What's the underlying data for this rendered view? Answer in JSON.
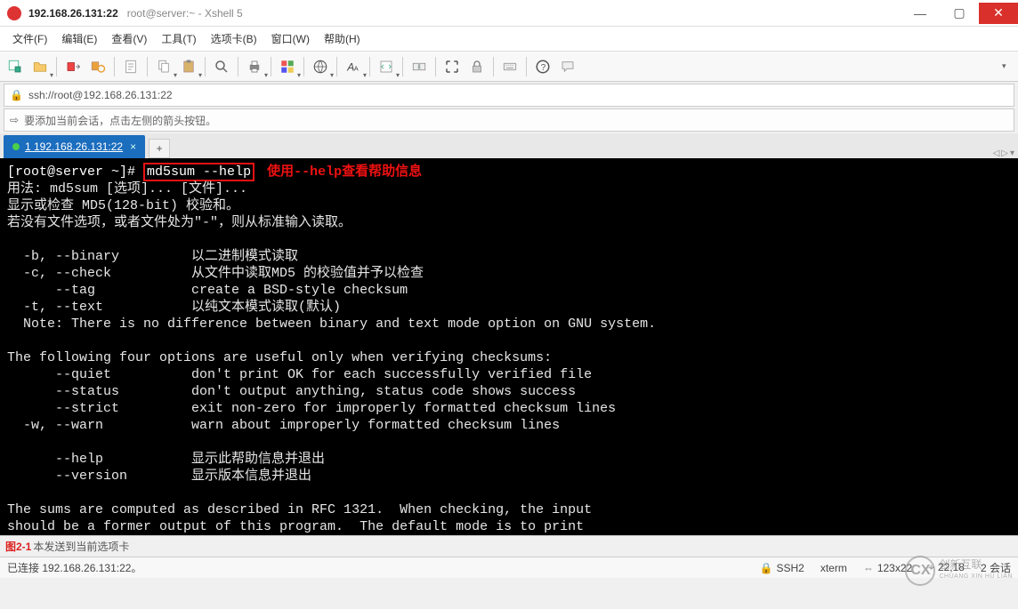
{
  "titlebar": {
    "host": "192.168.26.131:22",
    "caption": "root@server:~ - Xshell 5"
  },
  "win": {
    "min": "—",
    "max": "▢",
    "close": "✕"
  },
  "menu": [
    "文件(F)",
    "编辑(E)",
    "查看(V)",
    "工具(T)",
    "选项卡(B)",
    "窗口(W)",
    "帮助(H)"
  ],
  "addr": {
    "url": "ssh://root@192.168.26.131:22",
    "lock": "🔒"
  },
  "info": {
    "arrow": "⇨",
    "text": "要添加当前会话，点击左侧的箭头按钮。"
  },
  "tab": {
    "label": "1 192.168.26.131:22",
    "close": "×",
    "new": "+"
  },
  "tabnav": {
    "left": "◁",
    "right": "▷",
    "down": "▾"
  },
  "term": {
    "prompt": "[root@server ~]#",
    "cmd": "md5sum --help",
    "note": "使用--help查看帮助信息",
    "lines": [
      "用法: md5sum [选项]... [文件]...",
      "显示或检查 MD5(128-bit) 校验和。",
      "若没有文件选项，或者文件处为\"-\"，则从标准输入读取。",
      "",
      "  -b, --binary         以二进制模式读取",
      "  -c, --check          从文件中读取MD5 的校验值并予以检查",
      "      --tag            create a BSD-style checksum",
      "  -t, --text           以纯文本模式读取(默认)",
      "  Note: There is no difference between binary and text mode option on GNU system.",
      "",
      "The following four options are useful only when verifying checksums:",
      "      --quiet          don't print OK for each successfully verified file",
      "      --status         don't output anything, status code shows success",
      "      --strict         exit non-zero for improperly formatted checksum lines",
      "  -w, --warn           warn about improperly formatted checksum lines",
      "",
      "      --help           显示此帮助信息并退出",
      "      --version        显示版本信息并退出",
      "",
      "The sums are computed as described in RFC 1321.  When checking, the input",
      "should be a former output of this program.  The default mode is to print"
    ]
  },
  "footer1": {
    "fig": "图2-1",
    "text": "本发送到当前选项卡"
  },
  "footer2": {
    "conn": "已连接 192.168.26.131:22。",
    "ssh": "SSH2",
    "term": "xterm",
    "size": "123x22",
    "pos": "22,18",
    "sess": "2 会话"
  },
  "wm": {
    "name": "创新互联",
    "sub": "CHUANG XIN HU LIAN",
    "logo": "CX"
  }
}
